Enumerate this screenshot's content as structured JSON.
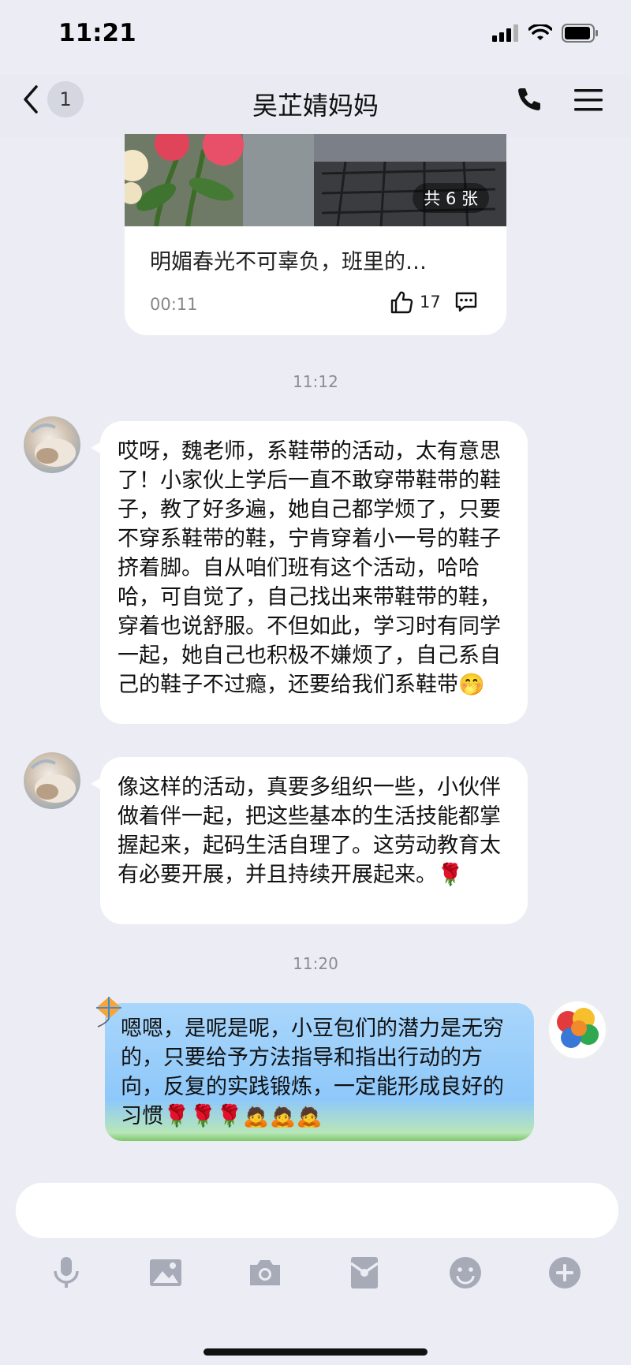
{
  "status_bar": {
    "time": "11:21"
  },
  "header": {
    "back_count": "1",
    "title": "吴芷婧妈妈"
  },
  "post_card": {
    "photo_count": "共 6 张",
    "title": "明媚春光不可辜负，班里的…",
    "time": "00:11",
    "likes": "17"
  },
  "timestamps": [
    "11:12",
    "11:20"
  ],
  "messages": [
    {
      "side": "left",
      "text": "哎呀，魏老师，系鞋带的活动，太有意思了！小家伙上学后一直不敢穿带鞋带的鞋子，教了好多遍，她自己都学烦了，只要不穿系鞋带的鞋，宁肯穿着小一号的鞋子挤着脚。自从咱们班有这个活动，哈哈哈，可自觉了，自己找出来带鞋带的鞋，穿着也说舒服。不但如此，学习时有同学一起，她自己也积极不嫌烦了，自己系自己的鞋子不过瘾，还要给我们系鞋带🤭"
    },
    {
      "side": "left",
      "text": "像这样的活动，真要多组织一些，小伙伴做着伴一起，把这些基本的生活技能都掌握起来，起码生活自理了。这劳动教育太有必要开展，并且持续开展起来。🌹"
    },
    {
      "side": "right",
      "text": "嗯嗯，是呢是呢，小豆包们的潜力是无穷的，只要给予方法指导和指出行动的方向，反复的实践锻炼，一定能形成良好的习惯🌹🌹🌹🙇🙇🙇"
    }
  ],
  "icons": {
    "toolbar": [
      "microphone-icon",
      "image-icon",
      "camera-icon",
      "red-packet-icon",
      "emoji-icon",
      "plus-icon"
    ]
  },
  "colors": {
    "background": "#ecedf4",
    "bubble": "#ffffff",
    "bubble_blue": "#a9d6fb"
  }
}
